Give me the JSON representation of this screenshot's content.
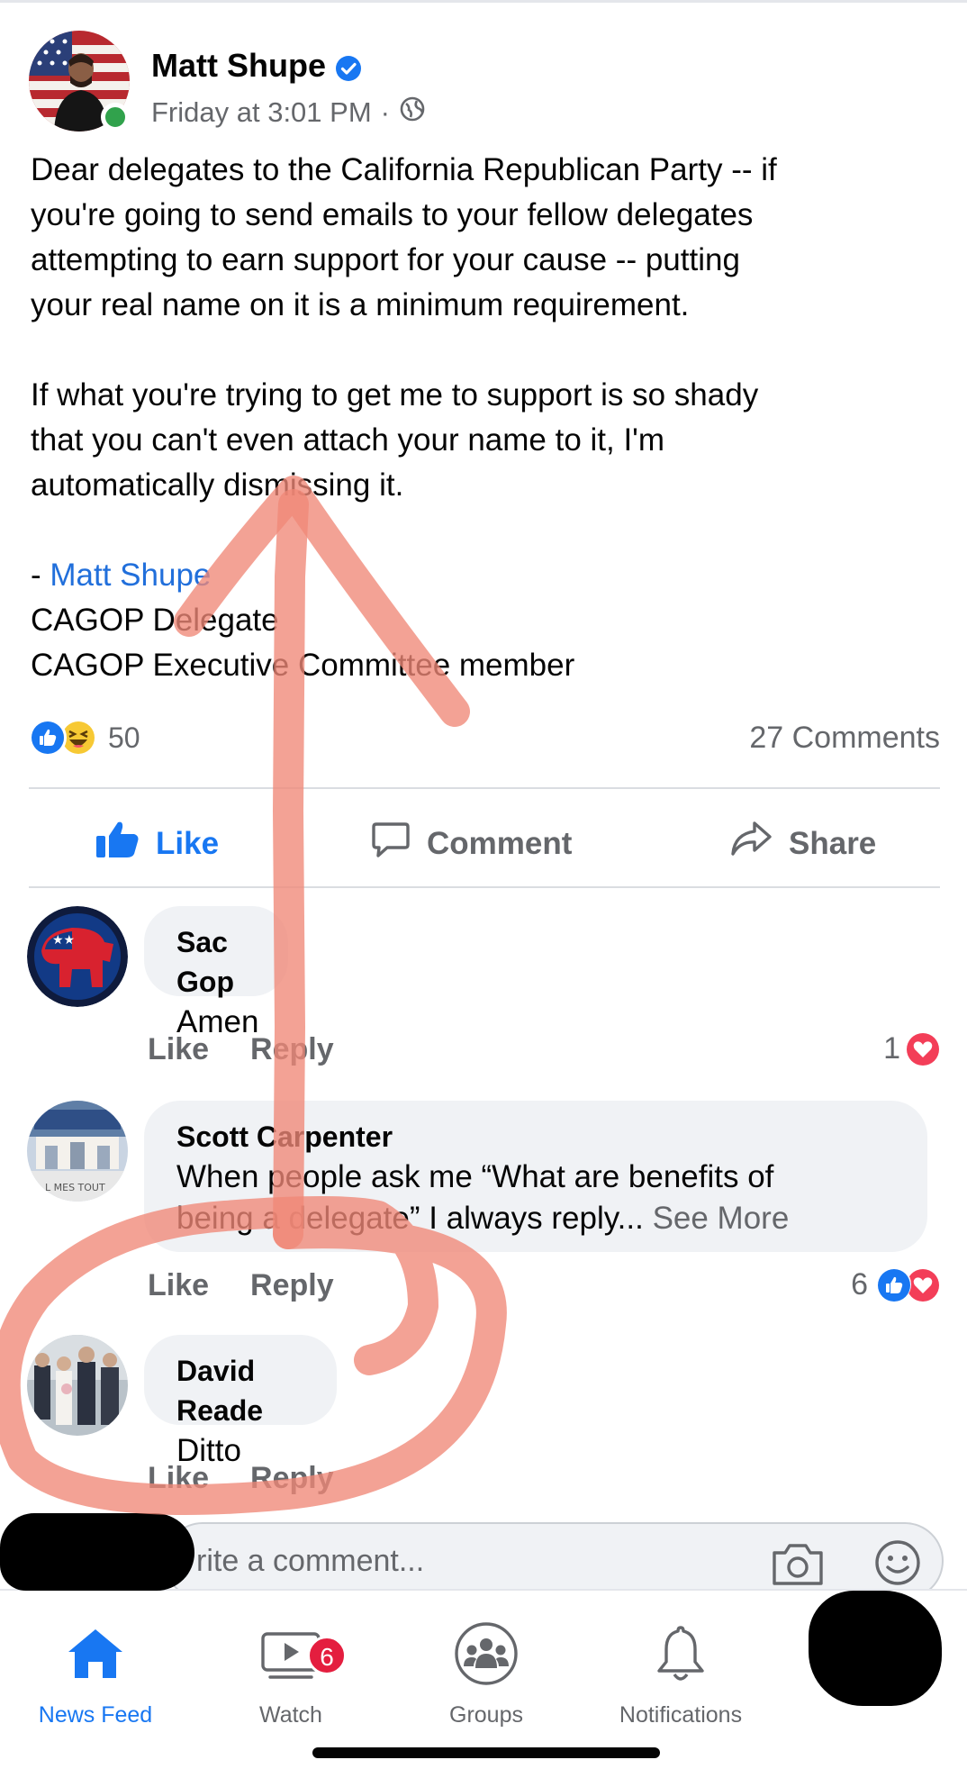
{
  "post": {
    "author": "Matt Shupe",
    "time": "Friday at 3:01 PM",
    "separator": "·",
    "body_lines_para1": [
      "Dear delegates to the California Republican Party -- if",
      "you're going to send emails to your fellow delegates",
      "attempting to earn support for your cause -- putting",
      "your real name on it is a minimum requirement."
    ],
    "body_lines_para2": [
      "If what you're trying to get me to support is so shady",
      "that you can't even attach your name to it, I'm",
      "automatically dismissing it."
    ],
    "signature_prefix": "- ",
    "signature_link": "Matt Shupe",
    "signature_line2": "CAGOP Delegate",
    "signature_line3": "CAGOP Executive Committee member",
    "reaction_count": "50",
    "comment_count": "27 Comments"
  },
  "actions": {
    "like": "Like",
    "comment": "Comment",
    "share": "Share"
  },
  "comments": [
    {
      "name": "Sac Gop",
      "text": "Amen",
      "like": "Like",
      "reply": "Reply",
      "reaction_count": "1"
    },
    {
      "name": "Scott Carpenter",
      "text_line1": "When people ask me “What are benefits of",
      "text_line2": "being a delegate” I always reply...",
      "see_more": "See More",
      "like": "Like",
      "reply": "Reply",
      "reaction_count": "6"
    },
    {
      "name": "David Reade",
      "text": "Ditto",
      "like": "Like",
      "reply": "Reply"
    }
  ],
  "write_comment": {
    "placeholder": "rite a comment..."
  },
  "nav": {
    "news_feed": "News Feed",
    "watch": "Watch",
    "watch_badge": "6",
    "groups": "Groups",
    "notifications": "Notifications"
  },
  "colors": {
    "facebook_blue": "#1877f2",
    "link_blue": "#216fdb",
    "secondary_text": "#65676b",
    "bubble_bg": "#f0f2f5",
    "love_red": "#f33e58",
    "badge_red": "#e41e3f",
    "annotation_stroke": "#f08877"
  },
  "icons": {
    "post_audience": "globe-icon",
    "verified": "verified-badge-icon",
    "like_action": "thumbs-up-icon",
    "comment_action": "speech-bubble-icon",
    "share_action": "share-arrow-icon",
    "camera": "camera-icon",
    "emoji": "emoji-icon",
    "nav_home": "home-icon",
    "nav_watch": "video-icon",
    "nav_groups": "groups-icon",
    "nav_notifications": "bell-icon"
  }
}
